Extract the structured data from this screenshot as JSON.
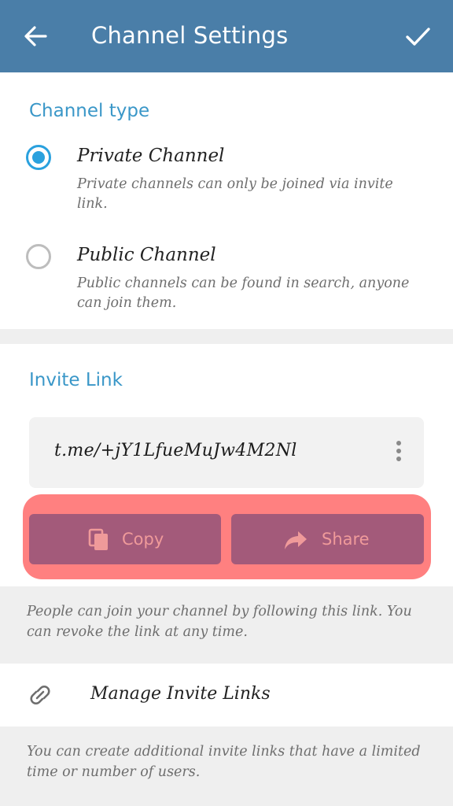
{
  "appbar": {
    "title": "Channel Settings",
    "back_icon": "arrow-left-icon",
    "done_icon": "check-icon"
  },
  "channel_type": {
    "header": "Channel type",
    "options": [
      {
        "title": "Private Channel",
        "description": "Private channels can only be joined via invite link.",
        "selected": true
      },
      {
        "title": "Public Channel",
        "description": "Public channels can be found in search, anyone can join them.",
        "selected": false
      }
    ]
  },
  "invite_link": {
    "header": "Invite Link",
    "link": "t.me/+jY1LfueMuJw4M2Nl",
    "copy_label": "Copy",
    "share_label": "Share",
    "info": "People can join your channel by following this link. You can revoke the link at any time."
  },
  "manage": {
    "label": "Manage Invite Links",
    "icon": "link-icon",
    "info": "You can create additional invite links that have a limited time or number of users."
  },
  "colors": {
    "appbar": "#4a7ea8",
    "accent": "#2aa1de",
    "section_header": "#3a97c8",
    "highlight": "#ff8080",
    "button": "#a35a7a"
  }
}
